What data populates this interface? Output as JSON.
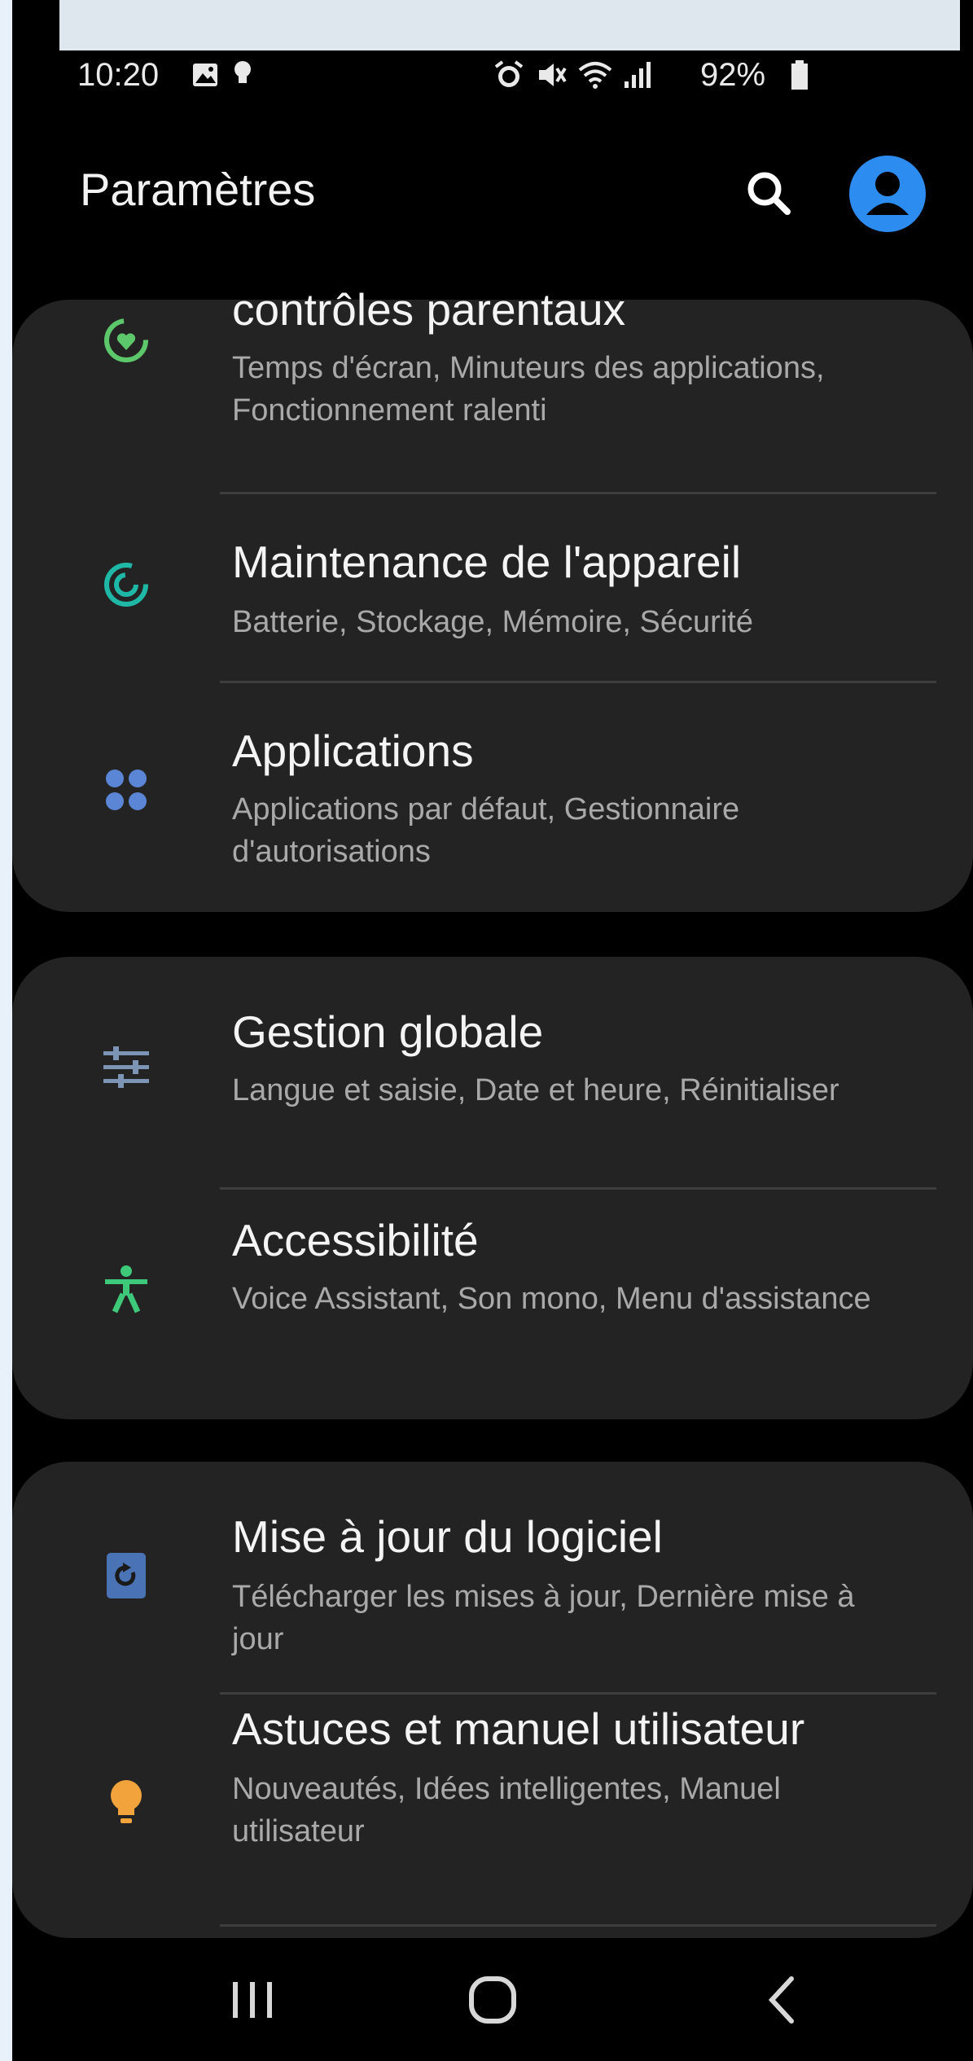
{
  "status": {
    "time": "10:20",
    "battery": "92%",
    "left_icons": [
      "gallery-icon",
      "bulb-notification-icon"
    ],
    "right_icons": [
      "alarm-icon",
      "mute-icon",
      "wifi-icon",
      "signal-icon",
      "battery-icon"
    ]
  },
  "header": {
    "title": "Paramètres",
    "accent": "#2c8cf0"
  },
  "groups": [
    {
      "items": [
        {
          "title": "contrôles parentaux",
          "subtitle": "Temps d'écran, Minuteurs des applications, Fonctionnement ralenti",
          "icon": "wellbeing-icon",
          "color": "#5dc86b"
        },
        {
          "title": "Maintenance de l'appareil",
          "subtitle": "Batterie, Stockage, Mémoire, Sécurité",
          "icon": "device-care-icon",
          "color": "#1fb7a6"
        },
        {
          "title": "Applications",
          "subtitle": "Applications par défaut, Gestionnaire d'autorisations",
          "icon": "apps-icon",
          "color": "#5b86d6"
        }
      ]
    },
    {
      "items": [
        {
          "title": "Gestion globale",
          "subtitle": "Langue et saisie, Date et heure, Réinitialiser",
          "icon": "sliders-icon",
          "color": "#7c95b5"
        },
        {
          "title": "Accessibilité",
          "subtitle": "Voice Assistant, Son mono, Menu d'assistance",
          "icon": "accessibility-icon",
          "color": "#3ec97a"
        }
      ]
    },
    {
      "items": [
        {
          "title": "Mise à jour du logiciel",
          "subtitle": "Télécharger les mises à jour, Dernière mise à jour",
          "icon": "software-update-icon",
          "color": "#4a73b5"
        },
        {
          "title": "Astuces et manuel utilisateur",
          "subtitle": "Nouveautés, Idées intelligentes, Manuel utilisateur",
          "icon": "tips-bulb-icon",
          "color": "#f3a33c"
        }
      ]
    }
  ],
  "navbar": {
    "buttons": [
      "recents-icon",
      "home-icon",
      "back-icon"
    ]
  }
}
